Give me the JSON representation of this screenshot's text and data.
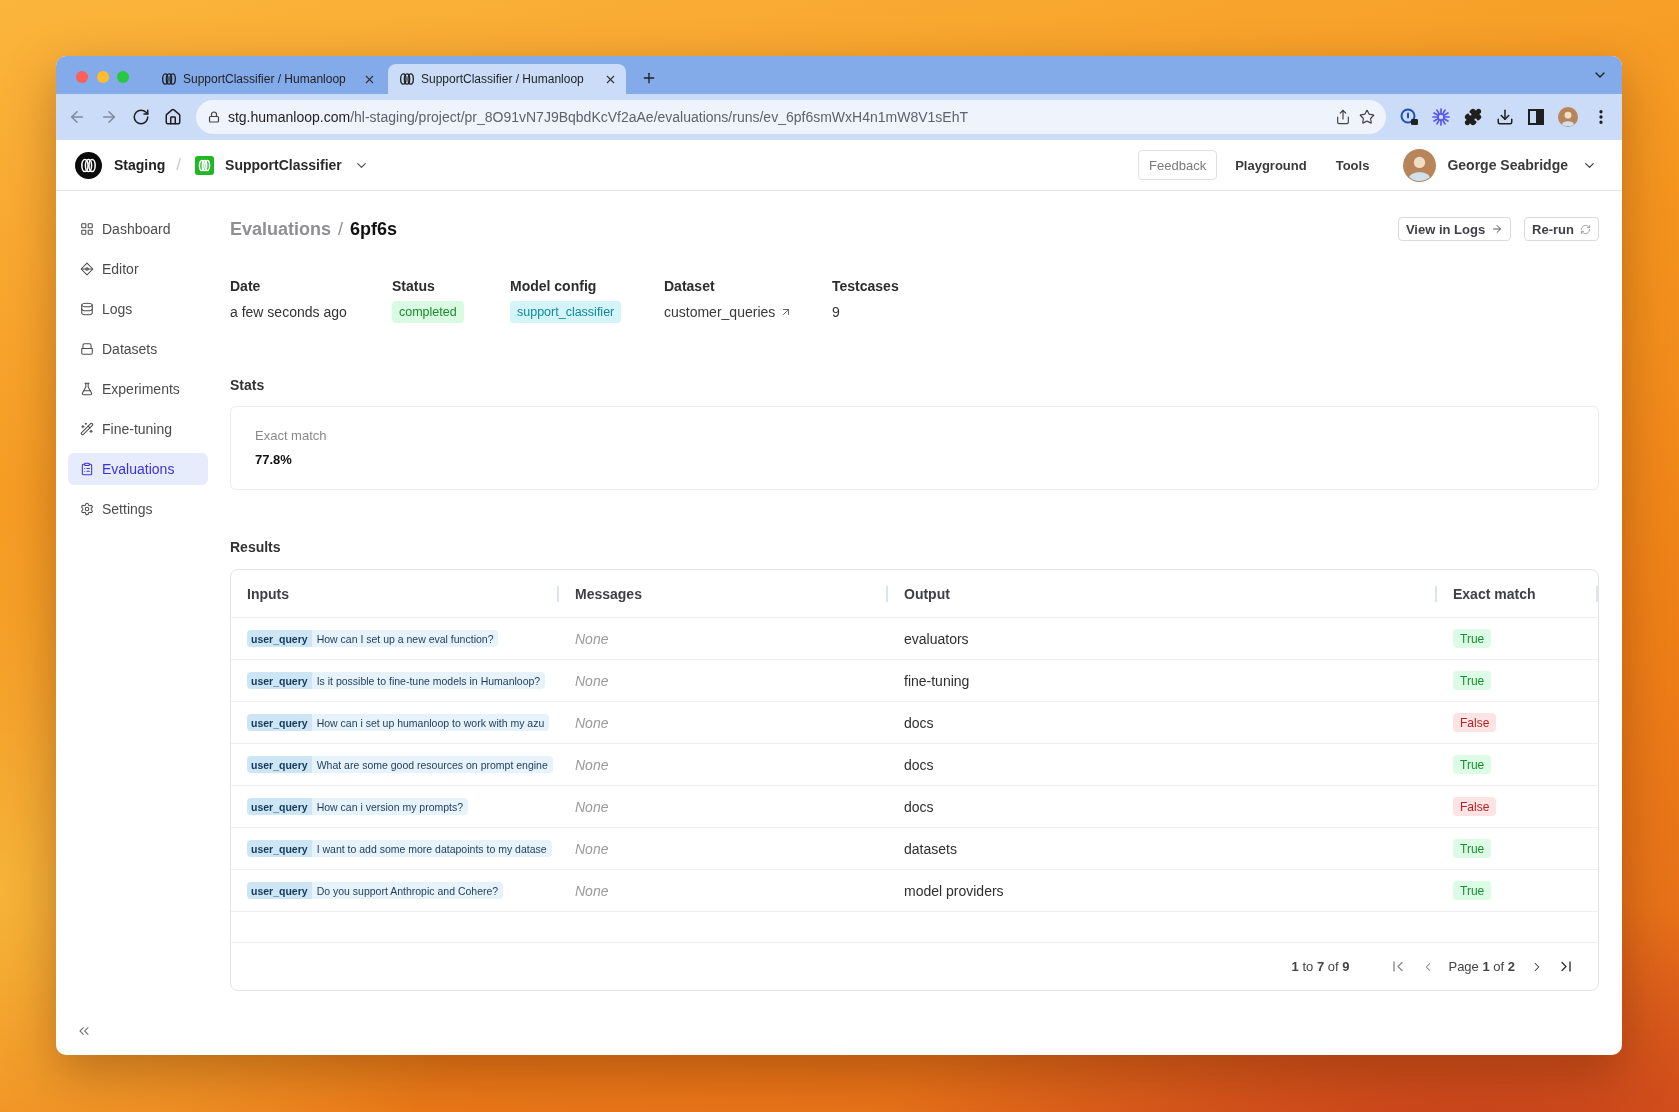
{
  "browser": {
    "tabs": [
      {
        "title": "SupportClassifier / Humanloop",
        "selected": false
      },
      {
        "title": "SupportClassifier / Humanloop",
        "selected": true
      }
    ],
    "address_bar": {
      "host": "stg.humanloop.com",
      "path": "/hl-staging/project/pr_8O91vN7J9BqbdKcVf2aAe/evaluations/runs/ev_6pf6smWxH4n1mW8V1sEhT"
    }
  },
  "header": {
    "workspace": "Staging",
    "separator": "/",
    "project": "SupportClassifier",
    "feedback": "Feedback",
    "nav_links": [
      "Playground",
      "Tools"
    ],
    "user_name": "George Seabridge"
  },
  "sidebar": {
    "items": [
      {
        "label": "Dashboard",
        "selected": false
      },
      {
        "label": "Editor",
        "selected": false
      },
      {
        "label": "Logs",
        "selected": false
      },
      {
        "label": "Datasets",
        "selected": false
      },
      {
        "label": "Experiments",
        "selected": false
      },
      {
        "label": "Fine-tuning",
        "selected": false
      },
      {
        "label": "Evaluations",
        "selected": true
      },
      {
        "label": "Settings",
        "selected": false
      }
    ]
  },
  "page": {
    "breadcrumb": {
      "parent": "Evaluations",
      "separator": "/",
      "current": "6pf6s"
    },
    "actions": [
      {
        "label": "View in Logs",
        "kind": "link"
      },
      {
        "label": "Re-run",
        "kind": "rerun"
      }
    ]
  },
  "details": [
    {
      "label": "Date",
      "value": "a few seconds ago",
      "kind": "text"
    },
    {
      "label": "Status",
      "value": "completed",
      "kind": "status"
    },
    {
      "label": "Model config",
      "value": "support_classifier",
      "kind": "config"
    },
    {
      "label": "Dataset",
      "value": "customer_queries",
      "kind": "link"
    },
    {
      "label": "Testcases",
      "value": "9",
      "kind": "text"
    }
  ],
  "stats": {
    "title": "Stats",
    "items": [
      {
        "label": "Exact match",
        "value": "77.8%"
      }
    ]
  },
  "results": {
    "title": "Results",
    "columns": [
      "Inputs",
      "Messages",
      "Output",
      "Exact match"
    ],
    "rows": [
      {
        "input_key": "user_query",
        "input_value": "How can I set up a new eval function?",
        "messages": "None",
        "output": "evaluators",
        "exact_match": "True",
        "passed": true
      },
      {
        "input_key": "user_query",
        "input_value": "Is it possible to fine-tune models in Humanloop?",
        "messages": "None",
        "output": "fine-tuning",
        "exact_match": "True",
        "passed": true
      },
      {
        "input_key": "user_query",
        "input_value": "How can i set up humanloop to work with my azu",
        "messages": "None",
        "output": "docs",
        "exact_match": "False",
        "passed": false
      },
      {
        "input_key": "user_query",
        "input_value": "What are some good resources on prompt engine",
        "messages": "None",
        "output": "docs",
        "exact_match": "True",
        "passed": true
      },
      {
        "input_key": "user_query",
        "input_value": "How can i version my prompts?",
        "messages": "None",
        "output": "docs",
        "exact_match": "False",
        "passed": false
      },
      {
        "input_key": "user_query",
        "input_value": "I want to add some more datapoints to my datase",
        "messages": "None",
        "output": "datasets",
        "exact_match": "True",
        "passed": true
      },
      {
        "input_key": "user_query",
        "input_value": "Do you support Anthropic and Cohere?",
        "messages": "None",
        "output": "model providers",
        "exact_match": "True",
        "passed": true
      }
    ],
    "pagination": {
      "range": "**1** to **7** of **9**",
      "page_label": "Page **1** of **2**"
    }
  }
}
